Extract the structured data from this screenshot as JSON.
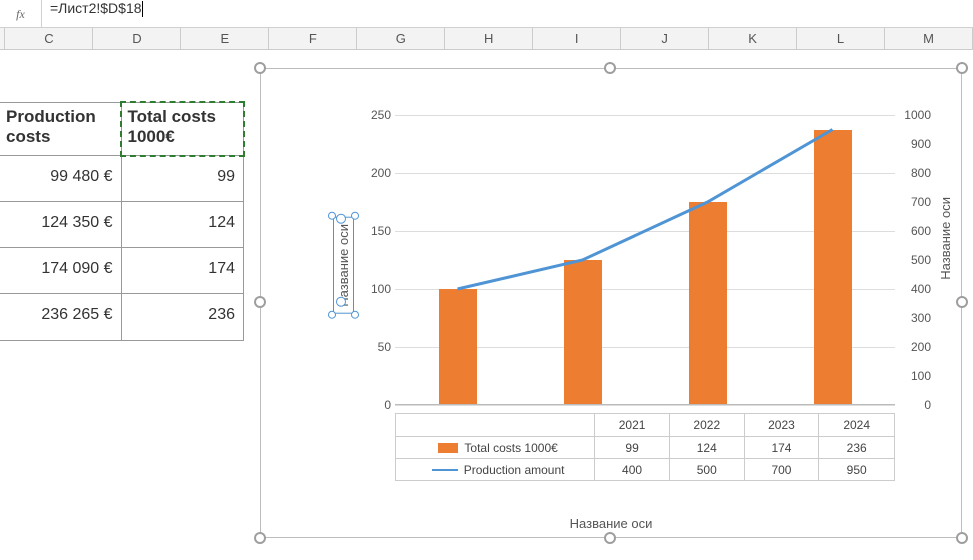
{
  "formula_bar": {
    "fx": "fx",
    "value": "=Лист2!$D$18"
  },
  "columns": [
    "C",
    "D",
    "E",
    "F",
    "G",
    "H",
    "I",
    "J",
    "K",
    "L",
    "M"
  ],
  "table": {
    "headers": {
      "c1": "Production costs",
      "c2": "Total costs 1000€"
    },
    "rows": [
      {
        "cost": "99 480 €",
        "k": "99"
      },
      {
        "cost": "124 350 €",
        "k": "124"
      },
      {
        "cost": "174 090 €",
        "k": "174"
      },
      {
        "cost": "236 265 €",
        "k": "236"
      }
    ]
  },
  "chart": {
    "axis_y_title": "Название оси",
    "axis_y2_title": "Название оси",
    "axis_x_title": "Название оси",
    "y_ticks": [
      "0",
      "50",
      "100",
      "150",
      "200",
      "250"
    ],
    "y2_ticks": [
      "0",
      "100",
      "200",
      "300",
      "400",
      "500",
      "600",
      "700",
      "800",
      "900",
      "1000"
    ],
    "cat_header": "",
    "legend": {
      "series1": "Total costs 1000€",
      "series2": "Production amount"
    }
  },
  "chart_data": {
    "type": "bar+line",
    "categories": [
      "2021",
      "2022",
      "2023",
      "2024"
    ],
    "series": [
      {
        "name": "Total costs 1000€",
        "kind": "bar",
        "axis": "left",
        "values": [
          99,
          124,
          174,
          236
        ]
      },
      {
        "name": "Production amount",
        "kind": "line",
        "axis": "right",
        "values": [
          400,
          500,
          700,
          950
        ]
      }
    ],
    "ylabel_left": "Название оси",
    "ylabel_right": "Название оси",
    "xlabel": "Название оси",
    "ylim_left": [
      0,
      250
    ],
    "ylim_right": [
      0,
      1000
    ]
  }
}
